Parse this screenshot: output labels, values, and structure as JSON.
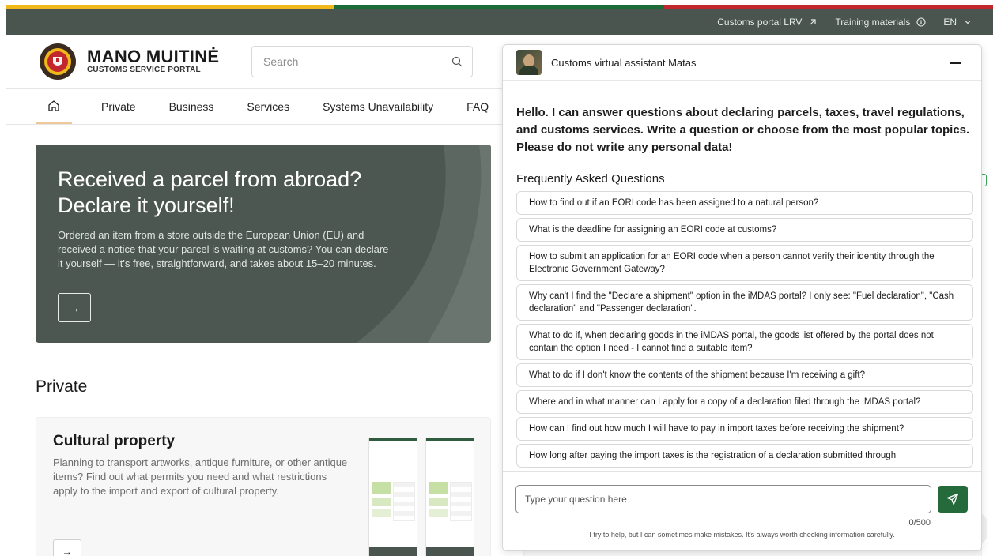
{
  "utility_bar": {
    "links": [
      {
        "label": "Customs portal LRV",
        "icon": "arrow-up-right-icon"
      },
      {
        "label": "Training materials",
        "icon": "info-icon"
      },
      {
        "label": "EN",
        "icon": "chevron-down-icon"
      }
    ]
  },
  "colors": {
    "flag_yellow": "#f1b81c",
    "flag_green": "#1e6b3a",
    "flag_red": "#c1272d",
    "utility_bar_bg": "#4a554f",
    "hero_bg": "#4d5751",
    "send_button": "#246a3b"
  },
  "brand": {
    "name": "MANO MUITINĖ",
    "subtitle": "CUSTOMS SERVICE PORTAL",
    "logo_icon": "lithuanian-customs-emblem"
  },
  "search": {
    "placeholder": "Search",
    "icon": "search-icon"
  },
  "nav": {
    "home_icon": "home-icon",
    "items": [
      "Private",
      "Business",
      "Services",
      "Systems Unavailability",
      "FAQ"
    ]
  },
  "hero": {
    "title": "Received a parcel from abroad? Declare it yourself!",
    "text": "Ordered an item from a store outside the European Union (EU) and received a notice that your parcel is waiting at customs? You can declare it yourself — it's free, straightforward, and takes about 15–20 minutes.",
    "button_icon": "arrow-right-icon",
    "button_label": "→"
  },
  "private_section": {
    "title": "Private",
    "card": {
      "title": "Cultural property",
      "text": "Planning to transport artworks, antique furniture, or other antique items? Find out what permits you need and what restrictions apply to the import and export of cultural property.",
      "button_label": "→"
    }
  },
  "chat": {
    "title": "Customs virtual assistant Matas",
    "avatar_icon": "assistant-avatar",
    "minimize_icon": "minimize-icon",
    "greeting": "Hello. I can answer questions about declaring parcels, taxes, travel regulations, and customs services. Write a question or choose from the most popular topics. Please do not write any personal data!",
    "faq_title": "Frequently Asked Questions",
    "faqs": [
      "How to find out if an EORI code has been assigned to a natural person?",
      "What is the deadline for assigning an EORI code at customs?",
      "How to submit an application for an EORI code when a person cannot verify their identity through the Electronic Government Gateway?",
      "Why can't I find the \"Declare a shipment\" option in the iMDAS portal? I only see: \"Fuel declaration\", \"Cash declaration\" and \"Passenger declaration\".",
      "What to do if, when declaring goods in the iMDAS portal, the goods list offered by the portal does not contain the option I need - I cannot find a suitable item?",
      "What to do if I don't know the contents of the shipment because I'm receiving a gift?",
      "Where and in what manner can I apply for a copy of a declaration filed through the iMDAS portal?",
      "How can I find out how much I will have to pay in import taxes before receiving the shipment?",
      "How long after paying the import taxes is the registration of a declaration submitted through"
    ],
    "input_placeholder": "Type your question here",
    "input_value": "",
    "counter": "0/500",
    "send_icon": "send-icon",
    "disclaimer": "I try to help, but I can sometimes make mistakes. It's always worth checking information carefully."
  }
}
